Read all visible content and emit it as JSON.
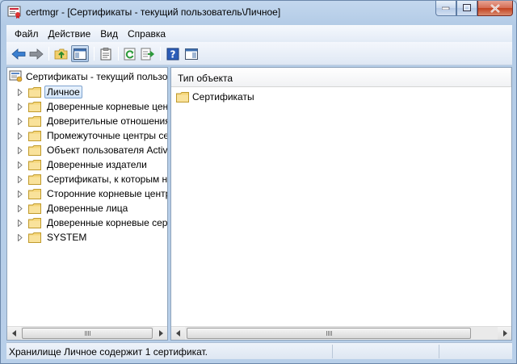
{
  "window": {
    "title": "certmgr - [Сертификаты - текущий пользователь\\Личное]"
  },
  "menu": {
    "items": [
      "Файл",
      "Действие",
      "Вид",
      "Справка"
    ]
  },
  "toolbar": {
    "buttons": [
      "back-icon",
      "forward-icon",
      "up-folder-icon",
      "show-hide-tree-icon",
      "properties-icon",
      "refresh-icon",
      "export-list-icon",
      "help-icon",
      "show-action-pane-icon"
    ]
  },
  "tree": {
    "root": "Сертификаты - текущий пользователь",
    "items": [
      "Личное",
      "Доверенные корневые центры сертификации",
      "Доверительные отношения в предприятии",
      "Промежуточные центры сертификации",
      "Объект пользователя Active Directory",
      "Доверенные издатели",
      "Сертификаты, к которым нет доверия",
      "Сторонние корневые центры сертификации",
      "Доверенные лица",
      "Доверенные корневые сертификаты смарт-карты",
      "SYSTEM"
    ],
    "selected_index": 0
  },
  "list": {
    "column_header": "Тип объекта",
    "items": [
      "Сертификаты"
    ]
  },
  "status": {
    "text": "Хранилище Личное содержит 1 сертификат."
  },
  "colors": {
    "folder": "#f5d67a",
    "selection": "#d2e4f8",
    "titlebar": "#b9d1ea"
  }
}
